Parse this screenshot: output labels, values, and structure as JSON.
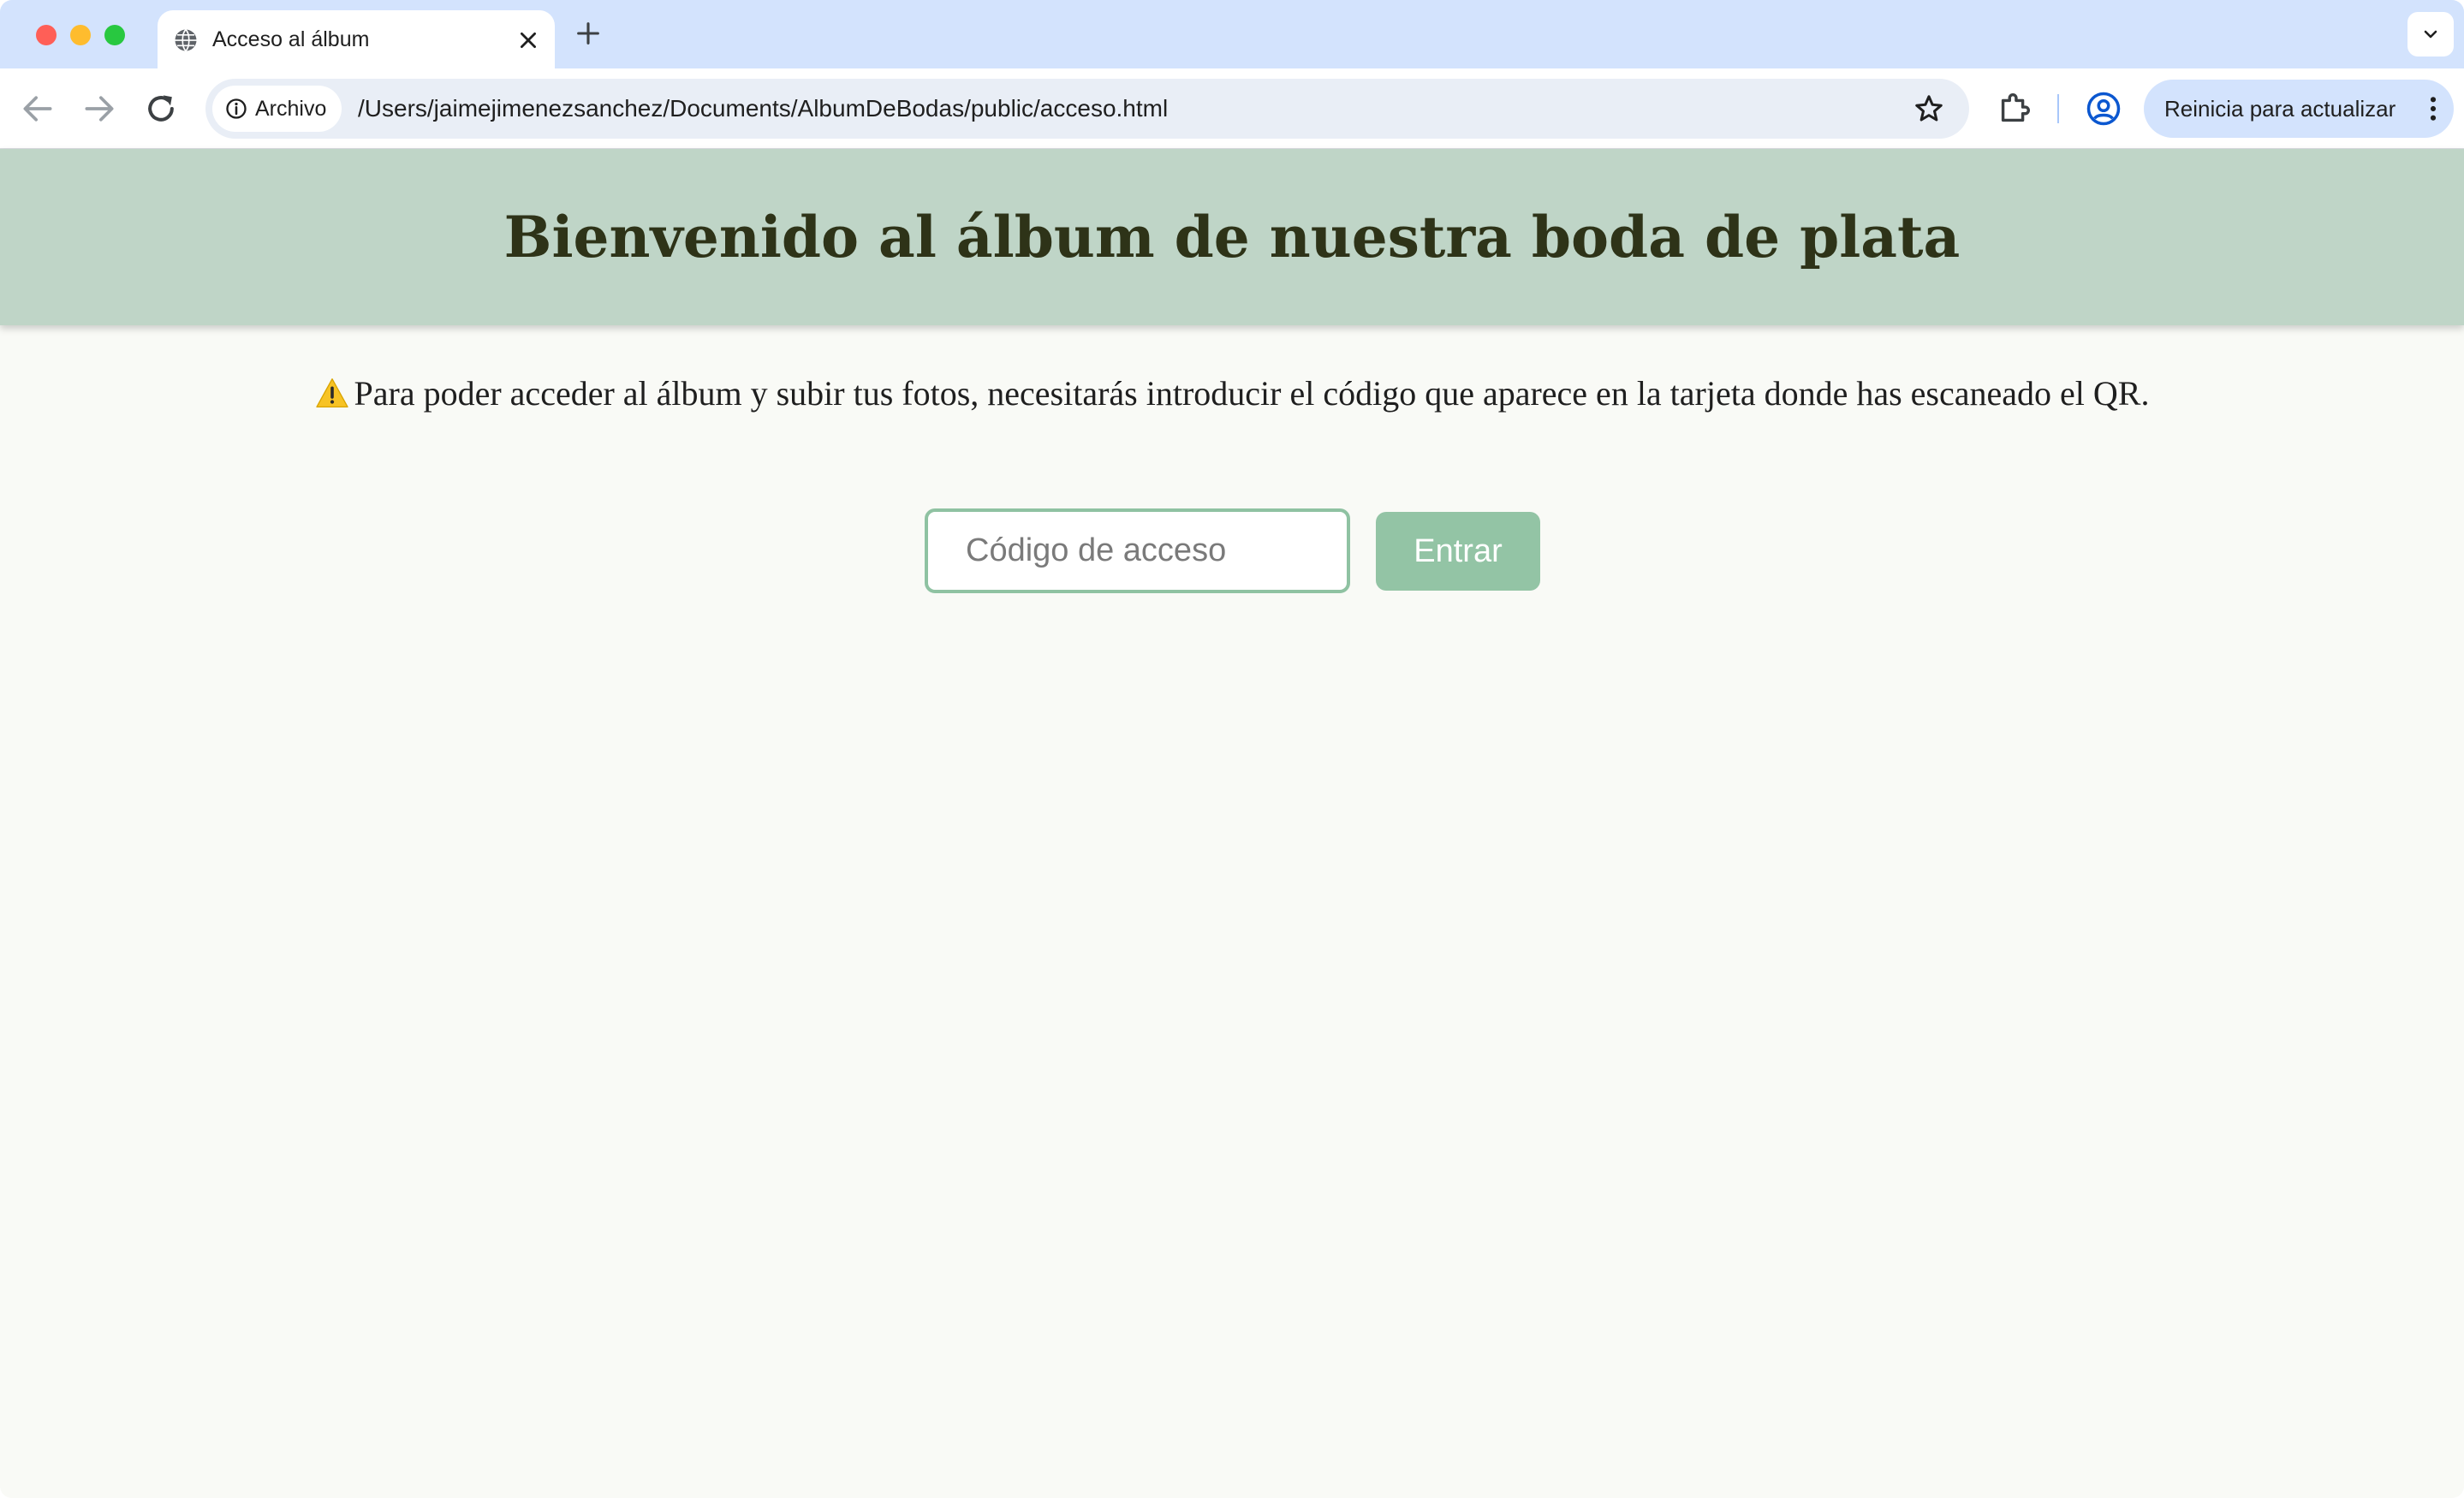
{
  "browser": {
    "tab": {
      "title": "Acceso al álbum"
    },
    "address_bar": {
      "security_chip": "Archivo",
      "url": "/Users/jaimejimenezsanchez/Documents/AlbumDeBodas/public/acceso.html"
    },
    "update_button": "Reinicia para actualizar"
  },
  "page": {
    "title": "Bienvenido al álbum de nuestra boda de plata",
    "notice_icon": "⚠️",
    "notice": "Para poder acceder al álbum y subir tus fotos, necesitarás introducir el código que aparece en la tarjeta donde has escaneado el QR.",
    "access_code_input": {
      "value": "",
      "placeholder": "Código de acceso"
    },
    "submit_button": "Entrar"
  },
  "colors": {
    "header_background": "#bfd5c7",
    "page_background": "#f9faf6",
    "title_text": "#2e3318",
    "accent": "#93c4a5",
    "input_border": "#8fc2a2",
    "tabstrip": "#d3e3fd"
  },
  "icons": {
    "traffic_lights": [
      "close-window-icon",
      "minimize-window-icon",
      "zoom-window-icon"
    ],
    "tab": [
      "globe-icon",
      "close-icon"
    ],
    "toolbar": [
      "back-arrow-icon",
      "forward-arrow-icon",
      "reload-icon",
      "info-icon",
      "star-icon",
      "extensions-puzzle-icon",
      "profile-icon",
      "kebab-menu-icon"
    ]
  }
}
